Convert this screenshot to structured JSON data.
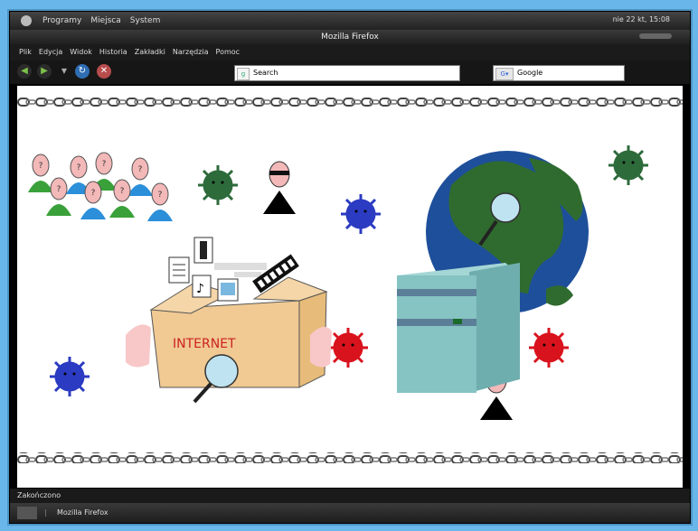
{
  "panel": {
    "menu_apps": "Programy",
    "menu_places": "Miejsca",
    "menu_system": "System",
    "clock": "nie 22 kt, 15:08"
  },
  "window": {
    "title": "Mozilla Firefox"
  },
  "menubar": {
    "items": [
      "Plik",
      "Edycja",
      "Widok",
      "Historia",
      "Zakładki",
      "Narzędzia",
      "Pomoc"
    ]
  },
  "toolbar": {
    "url_value": "Search",
    "search_engine": "Google"
  },
  "illustration": {
    "box_label": "INTERNET",
    "question_mark": "?"
  },
  "status": {
    "text": "Zakończono"
  },
  "taskbar": {
    "task": "Mozilla Firefox"
  },
  "colors": {
    "box": "#f0c993",
    "server": "#86c3c3",
    "ocean": "#1e4f9a",
    "land": "#2f6b2f",
    "virus_red": "#d9131d",
    "virus_blue": "#2b3bc2",
    "virus_green": "#2e6b3b"
  }
}
